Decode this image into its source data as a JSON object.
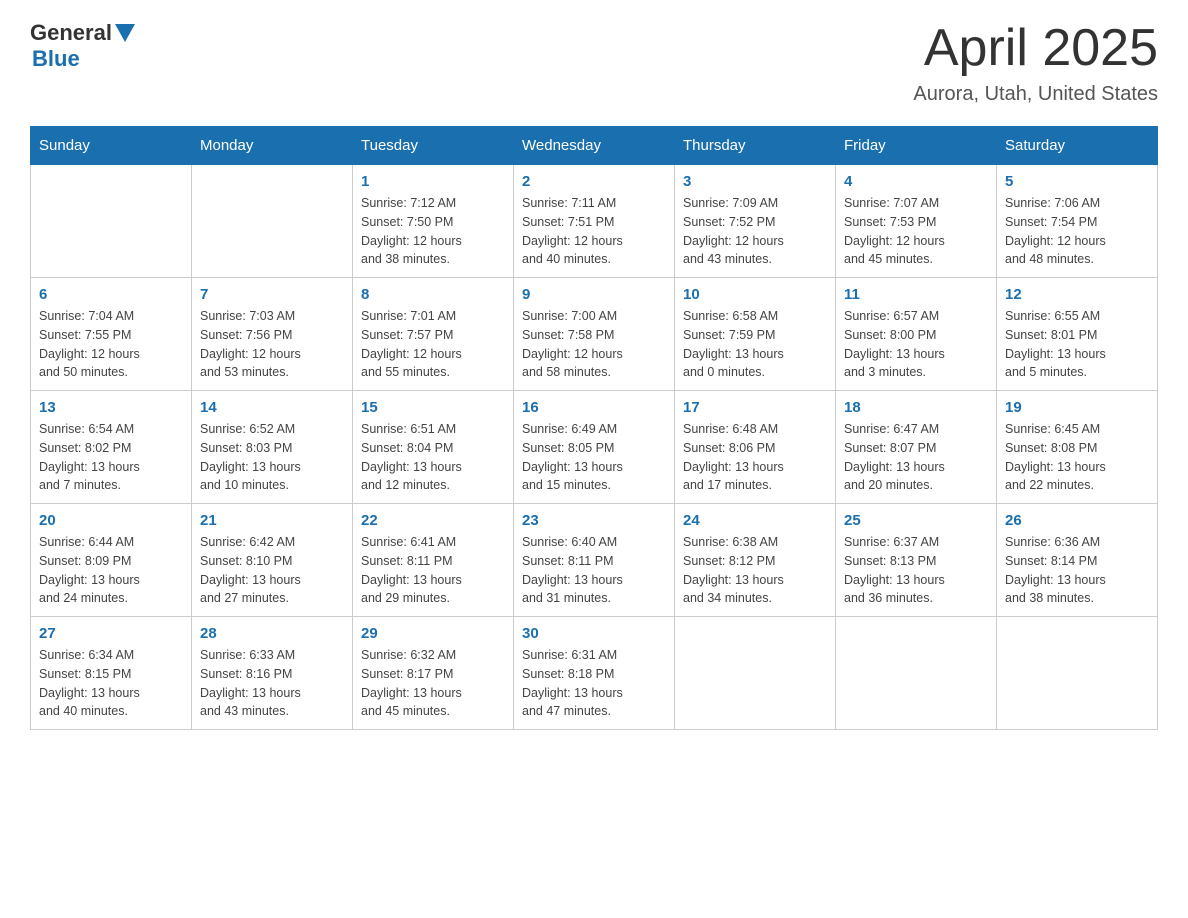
{
  "header": {
    "logo_general": "General",
    "logo_blue": "Blue",
    "month": "April 2025",
    "location": "Aurora, Utah, United States"
  },
  "weekdays": [
    "Sunday",
    "Monday",
    "Tuesday",
    "Wednesday",
    "Thursday",
    "Friday",
    "Saturday"
  ],
  "weeks": [
    [
      {
        "day": "",
        "info": ""
      },
      {
        "day": "",
        "info": ""
      },
      {
        "day": "1",
        "info": "Sunrise: 7:12 AM\nSunset: 7:50 PM\nDaylight: 12 hours\nand 38 minutes."
      },
      {
        "day": "2",
        "info": "Sunrise: 7:11 AM\nSunset: 7:51 PM\nDaylight: 12 hours\nand 40 minutes."
      },
      {
        "day": "3",
        "info": "Sunrise: 7:09 AM\nSunset: 7:52 PM\nDaylight: 12 hours\nand 43 minutes."
      },
      {
        "day": "4",
        "info": "Sunrise: 7:07 AM\nSunset: 7:53 PM\nDaylight: 12 hours\nand 45 minutes."
      },
      {
        "day": "5",
        "info": "Sunrise: 7:06 AM\nSunset: 7:54 PM\nDaylight: 12 hours\nand 48 minutes."
      }
    ],
    [
      {
        "day": "6",
        "info": "Sunrise: 7:04 AM\nSunset: 7:55 PM\nDaylight: 12 hours\nand 50 minutes."
      },
      {
        "day": "7",
        "info": "Sunrise: 7:03 AM\nSunset: 7:56 PM\nDaylight: 12 hours\nand 53 minutes."
      },
      {
        "day": "8",
        "info": "Sunrise: 7:01 AM\nSunset: 7:57 PM\nDaylight: 12 hours\nand 55 minutes."
      },
      {
        "day": "9",
        "info": "Sunrise: 7:00 AM\nSunset: 7:58 PM\nDaylight: 12 hours\nand 58 minutes."
      },
      {
        "day": "10",
        "info": "Sunrise: 6:58 AM\nSunset: 7:59 PM\nDaylight: 13 hours\nand 0 minutes."
      },
      {
        "day": "11",
        "info": "Sunrise: 6:57 AM\nSunset: 8:00 PM\nDaylight: 13 hours\nand 3 minutes."
      },
      {
        "day": "12",
        "info": "Sunrise: 6:55 AM\nSunset: 8:01 PM\nDaylight: 13 hours\nand 5 minutes."
      }
    ],
    [
      {
        "day": "13",
        "info": "Sunrise: 6:54 AM\nSunset: 8:02 PM\nDaylight: 13 hours\nand 7 minutes."
      },
      {
        "day": "14",
        "info": "Sunrise: 6:52 AM\nSunset: 8:03 PM\nDaylight: 13 hours\nand 10 minutes."
      },
      {
        "day": "15",
        "info": "Sunrise: 6:51 AM\nSunset: 8:04 PM\nDaylight: 13 hours\nand 12 minutes."
      },
      {
        "day": "16",
        "info": "Sunrise: 6:49 AM\nSunset: 8:05 PM\nDaylight: 13 hours\nand 15 minutes."
      },
      {
        "day": "17",
        "info": "Sunrise: 6:48 AM\nSunset: 8:06 PM\nDaylight: 13 hours\nand 17 minutes."
      },
      {
        "day": "18",
        "info": "Sunrise: 6:47 AM\nSunset: 8:07 PM\nDaylight: 13 hours\nand 20 minutes."
      },
      {
        "day": "19",
        "info": "Sunrise: 6:45 AM\nSunset: 8:08 PM\nDaylight: 13 hours\nand 22 minutes."
      }
    ],
    [
      {
        "day": "20",
        "info": "Sunrise: 6:44 AM\nSunset: 8:09 PM\nDaylight: 13 hours\nand 24 minutes."
      },
      {
        "day": "21",
        "info": "Sunrise: 6:42 AM\nSunset: 8:10 PM\nDaylight: 13 hours\nand 27 minutes."
      },
      {
        "day": "22",
        "info": "Sunrise: 6:41 AM\nSunset: 8:11 PM\nDaylight: 13 hours\nand 29 minutes."
      },
      {
        "day": "23",
        "info": "Sunrise: 6:40 AM\nSunset: 8:11 PM\nDaylight: 13 hours\nand 31 minutes."
      },
      {
        "day": "24",
        "info": "Sunrise: 6:38 AM\nSunset: 8:12 PM\nDaylight: 13 hours\nand 34 minutes."
      },
      {
        "day": "25",
        "info": "Sunrise: 6:37 AM\nSunset: 8:13 PM\nDaylight: 13 hours\nand 36 minutes."
      },
      {
        "day": "26",
        "info": "Sunrise: 6:36 AM\nSunset: 8:14 PM\nDaylight: 13 hours\nand 38 minutes."
      }
    ],
    [
      {
        "day": "27",
        "info": "Sunrise: 6:34 AM\nSunset: 8:15 PM\nDaylight: 13 hours\nand 40 minutes."
      },
      {
        "day": "28",
        "info": "Sunrise: 6:33 AM\nSunset: 8:16 PM\nDaylight: 13 hours\nand 43 minutes."
      },
      {
        "day": "29",
        "info": "Sunrise: 6:32 AM\nSunset: 8:17 PM\nDaylight: 13 hours\nand 45 minutes."
      },
      {
        "day": "30",
        "info": "Sunrise: 6:31 AM\nSunset: 8:18 PM\nDaylight: 13 hours\nand 47 minutes."
      },
      {
        "day": "",
        "info": ""
      },
      {
        "day": "",
        "info": ""
      },
      {
        "day": "",
        "info": ""
      }
    ]
  ]
}
